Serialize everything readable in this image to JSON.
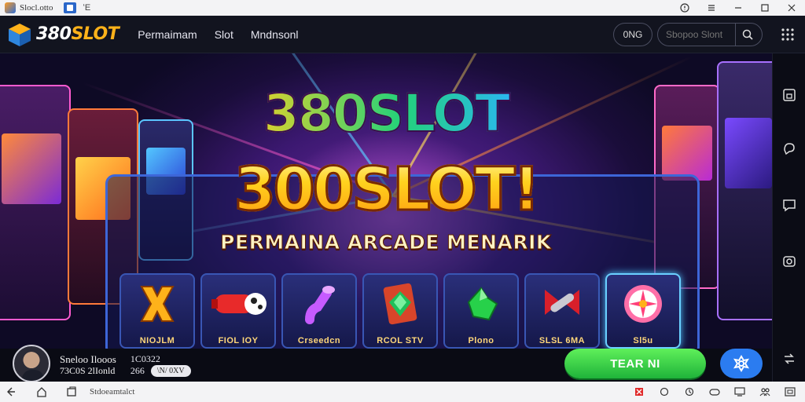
{
  "window": {
    "title": "Slocl.otto",
    "tab_label": "ʻE",
    "controls": [
      "minimize-icon",
      "restore-icon",
      "close-icon"
    ]
  },
  "header": {
    "logo_number": "380",
    "logo_word": "SLOT",
    "nav": [
      "Permaimam",
      "Slot",
      "Mndnsonl"
    ],
    "lang_button": "0NG",
    "search_placeholder": "Sbopoo Slont",
    "icons": [
      "search-icon",
      "apps-grid-icon"
    ]
  },
  "banner": {
    "title_line1": "380SLOT",
    "title_line2": "300SLOT!",
    "subtitle": "PERMAINA ARCADE MENARIK",
    "cards": [
      {
        "label": "NIOJLM",
        "icon": "x-symbol-icon"
      },
      {
        "label": "FIOL IOY",
        "icon": "rocket-icon"
      },
      {
        "label": "Crseedcn",
        "icon": "pipe-icon"
      },
      {
        "label": "RCOL STV",
        "icon": "emerald-card-icon"
      },
      {
        "label": "Plono",
        "icon": "green-gem-icon"
      },
      {
        "label": "SLSL 6MA",
        "icon": "bow-key-icon"
      },
      {
        "label": "Sl5u",
        "icon": "candy-wheel-icon"
      }
    ]
  },
  "player": {
    "name": "Sneloo Ilooos",
    "id_line": "73C0S 2lIonld",
    "stat_1": "1C0322",
    "stat_2": "266",
    "stat_pill": "\\N/ 0XV",
    "play_button": "TEAR NI",
    "fab_icon": "flower-icon"
  },
  "sidebar_icons": [
    "save-icon",
    "chat-icon",
    "message-icon",
    "camera-icon",
    "swap-icon"
  ],
  "taskbar": {
    "label": "Stdoeamtalct",
    "left_icons": [
      "back-icon",
      "home-icon",
      "recent-icon"
    ],
    "tray_icons": [
      "flag-icon",
      "refresh-icon",
      "clock-icon",
      "gamepad-icon",
      "screen-icon",
      "people-icon",
      "fullscreen-icon"
    ]
  },
  "colors": {
    "accent_orange": "#ffb21a",
    "play_green": "#2ecc40",
    "fab_blue": "#2b7cf0",
    "panel_blue": "#3d66d8",
    "header_bg": "#12141f"
  }
}
